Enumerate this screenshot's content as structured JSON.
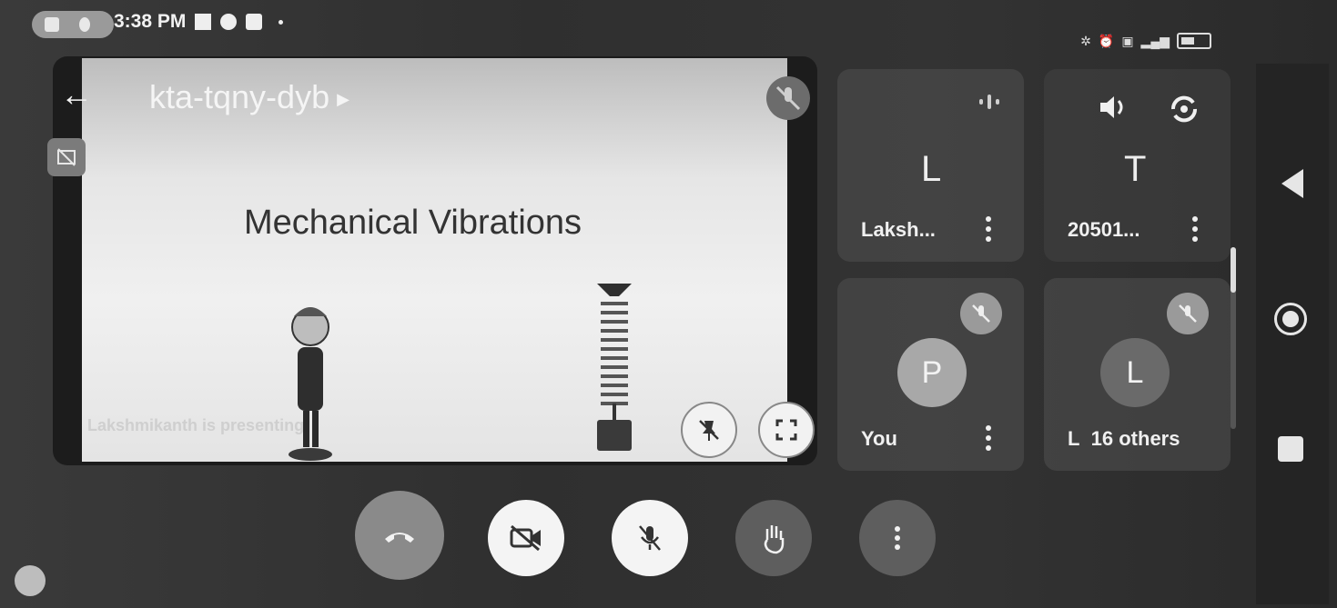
{
  "status_bar": {
    "time": "3:38 PM",
    "right_icons": [
      "settings-gear-icon",
      "alarm-icon",
      "sim-icon",
      "signal-icon",
      "battery-icon"
    ]
  },
  "meeting": {
    "code": "kta-tqny-dyb",
    "presenting_text": "Lakshmikanth is presenting"
  },
  "slide": {
    "title": "Mechanical Vibrations"
  },
  "participants": [
    {
      "initial": "L",
      "name": "Laksh...",
      "state": "speaking"
    },
    {
      "initial": "T",
      "name": "20501...",
      "state": "unmuted"
    },
    {
      "initial": "P",
      "name": "You",
      "state": "muted"
    },
    {
      "initial": "L",
      "name": "L  16 others",
      "state": "muted"
    }
  ],
  "controls": [
    {
      "name": "end-call-button",
      "icon": "phone-hangup-icon"
    },
    {
      "name": "camera-toggle-button",
      "icon": "video-off-icon"
    },
    {
      "name": "mic-toggle-button",
      "icon": "mic-off-icon"
    },
    {
      "name": "raise-hand-button",
      "icon": "hand-icon"
    },
    {
      "name": "more-options-button",
      "icon": "more-vert-icon"
    }
  ],
  "colors": {
    "end_call": "#8a8a8a",
    "control_light": "#f4f4f4",
    "control_dark": "#5e5e5e"
  }
}
